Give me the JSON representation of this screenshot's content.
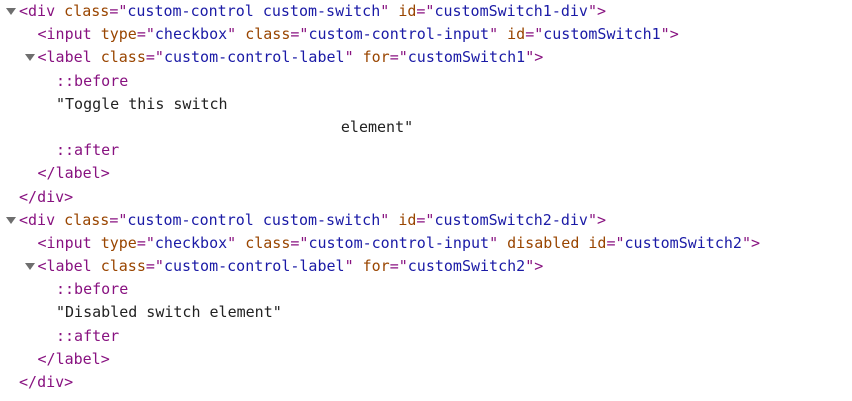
{
  "nodes": [
    {
      "indent": 0,
      "toggle": true,
      "kind": "open",
      "tag": "div",
      "attrs": [
        {
          "name": "class",
          "value": "custom-control custom-switch"
        },
        {
          "name": "id",
          "value": "customSwitch1-div"
        }
      ]
    },
    {
      "indent": 1,
      "toggle": false,
      "kind": "selfopen",
      "tag": "input",
      "attrs": [
        {
          "name": "type",
          "value": "checkbox"
        },
        {
          "name": "class",
          "value": "custom-control-input"
        },
        {
          "name": "id",
          "value": "customSwitch1"
        }
      ]
    },
    {
      "indent": 1,
      "toggle": true,
      "kind": "open",
      "tag": "label",
      "attrs": [
        {
          "name": "class",
          "value": "custom-control-label"
        },
        {
          "name": "for",
          "value": "customSwitch1"
        }
      ]
    },
    {
      "indent": 2,
      "toggle": false,
      "kind": "pseudo",
      "text": "::before"
    },
    {
      "indent": 2,
      "toggle": false,
      "kind": "text",
      "text": "\"Toggle this switch"
    },
    {
      "indent": 17.4,
      "toggle": false,
      "kind": "text",
      "text": "element\""
    },
    {
      "indent": 2,
      "toggle": false,
      "kind": "pseudo",
      "text": "::after"
    },
    {
      "indent": 1,
      "toggle": false,
      "kind": "close",
      "tag": "label"
    },
    {
      "indent": 0,
      "toggle": false,
      "kind": "close",
      "tag": "div"
    },
    {
      "indent": 0,
      "toggle": true,
      "kind": "open",
      "tag": "div",
      "attrs": [
        {
          "name": "class",
          "value": "custom-control custom-switch"
        },
        {
          "name": "id",
          "value": "customSwitch2-div"
        }
      ]
    },
    {
      "indent": 1,
      "toggle": false,
      "kind": "selfopen",
      "tag": "input",
      "attrs": [
        {
          "name": "type",
          "value": "checkbox"
        },
        {
          "name": "class",
          "value": "custom-control-input"
        },
        {
          "name": "disabled",
          "value": null
        },
        {
          "name": "id",
          "value": "customSwitch2"
        }
      ]
    },
    {
      "indent": 1,
      "toggle": true,
      "kind": "open",
      "tag": "label",
      "attrs": [
        {
          "name": "class",
          "value": "custom-control-label"
        },
        {
          "name": "for",
          "value": "customSwitch2"
        }
      ]
    },
    {
      "indent": 2,
      "toggle": false,
      "kind": "pseudo",
      "text": "::before"
    },
    {
      "indent": 2,
      "toggle": false,
      "kind": "text",
      "text": "\"Disabled switch element\""
    },
    {
      "indent": 2,
      "toggle": false,
      "kind": "pseudo",
      "text": "::after"
    },
    {
      "indent": 1,
      "toggle": false,
      "kind": "close",
      "tag": "label"
    },
    {
      "indent": 0,
      "toggle": false,
      "kind": "close",
      "tag": "div"
    }
  ]
}
